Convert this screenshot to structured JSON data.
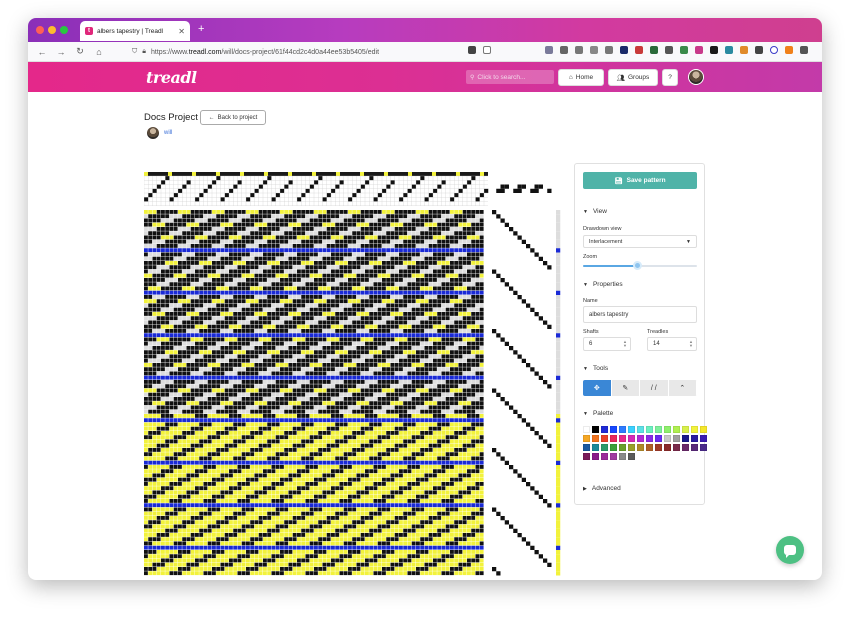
{
  "browser": {
    "tab_title": "albers tapestry | Treadl",
    "tab_close": "✕",
    "new_tab": "+",
    "url_prefix": "https://www.",
    "url_host": "treadl.com",
    "url_path": "/will/docs-project/61f44cd2c4d0a44ee53b5405/edit"
  },
  "header": {
    "logo": "treadl",
    "search_placeholder": "Click to search...",
    "home_label": "Home",
    "groups_label": "Groups",
    "help_label": "?"
  },
  "project": {
    "title": "Docs Project",
    "back_label": "Back to project",
    "owner": "will"
  },
  "sidebar": {
    "save_label": "Save pattern",
    "view_heading": "View",
    "drawdown_label": "Drawdown view",
    "drawdown_value": "Interlacement",
    "zoom_label": "Zoom",
    "zoom_level": 0.48,
    "properties_heading": "Properties",
    "name_label": "Name",
    "name_value": "albers tapestry",
    "shafts_label": "Shafts",
    "shafts_value": "6",
    "treadles_label": "Treadles",
    "treadles_value": "14",
    "tools_heading": "Tools",
    "tools": [
      "✥",
      "✎",
      "/ /",
      "⌃"
    ],
    "palette_heading": "Palette",
    "advanced_heading": "Advanced",
    "palette": [
      "#ffffff",
      "#000000",
      "#1f2ad6",
      "#1748ff",
      "#2e7bff",
      "#3ad0ff",
      "#5ce0e6",
      "#6cf0c0",
      "#7ff09c",
      "#8ef06b",
      "#b0f050",
      "#d8f04a",
      "#f2f23c",
      "#f5e62a",
      "#f5a623",
      "#f0731f",
      "#e8402a",
      "#e8285c",
      "#e82a8c",
      "#d62ab8",
      "#b22ad6",
      "#8a2ae8",
      "#6a2af0",
      "#c8c8c8",
      "#a0a0a0",
      "#1a1a8a",
      "#2a1aa0",
      "#3a1ab0",
      "#1a5aa0",
      "#1a8a9a",
      "#2a9a6a",
      "#3aa03a",
      "#6aa02a",
      "#9aa02a",
      "#b08a2a",
      "#b0602a",
      "#a03a2a",
      "#8a2a2a",
      "#7a2a4a",
      "#6a2a6a",
      "#5a2a7a",
      "#4a2a8a",
      "#7a1a5a",
      "#8a1a8a",
      "#9a2a9a",
      "#a03aa0",
      "#8a8a8a",
      "#5a5a5a"
    ]
  }
}
